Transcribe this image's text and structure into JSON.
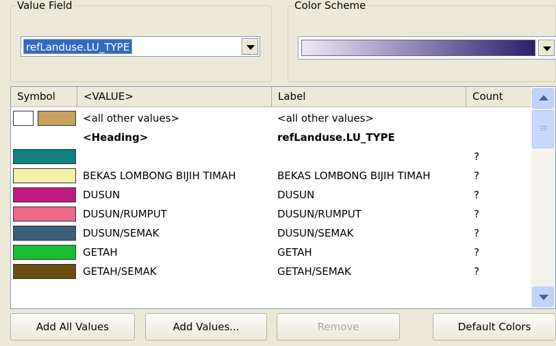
{
  "value_field": {
    "legend": "Value Field",
    "selected": "refLanduse.LU_TYPE"
  },
  "color_scheme": {
    "legend": "Color Scheme",
    "ramp_start": "#efe8f7",
    "ramp_end": "#2d1e6e"
  },
  "table": {
    "headers": [
      "Symbol",
      "<VALUE>",
      "Label",
      "Count"
    ],
    "rows": [
      {
        "swatch": "#c8a060",
        "has_blank": true,
        "value": "<all other values>",
        "label": "<all other values>",
        "count": ""
      },
      {
        "swatch": "",
        "has_blank": false,
        "value": "<Heading>",
        "label": "refLanduse.LU_TYPE",
        "count": "",
        "bold": true
      },
      {
        "swatch": "#108080",
        "has_blank": false,
        "value": "",
        "label": "",
        "count": "?"
      },
      {
        "swatch": "#f5f0a8",
        "has_blank": false,
        "value": "BEKAS LOMBONG BIJIH TIMAH",
        "label": "BEKAS LOMBONG BIJIH TIMAH",
        "count": "?"
      },
      {
        "swatch": "#c01a80",
        "has_blank": false,
        "value": "DUSUN",
        "label": "DUSUN",
        "count": "?"
      },
      {
        "swatch": "#f06888",
        "has_blank": false,
        "value": "DUSUN/RUMPUT",
        "label": "DUSUN/RUMPUT",
        "count": "?"
      },
      {
        "swatch": "#3a6078",
        "has_blank": false,
        "value": "DUSUN/SEMAK",
        "label": "DUSUN/SEMAK",
        "count": "?"
      },
      {
        "swatch": "#18c030",
        "has_blank": false,
        "value": "GETAH",
        "label": "GETAH",
        "count": "?"
      },
      {
        "swatch": "#6a5010",
        "has_blank": false,
        "value": "GETAH/SEMAK",
        "label": "GETAH/SEMAK",
        "count": "?"
      }
    ]
  },
  "buttons": {
    "add_all": "Add All Values",
    "add_values": "Add Values...",
    "remove": "Remove",
    "default_colors": "Default Colors"
  }
}
